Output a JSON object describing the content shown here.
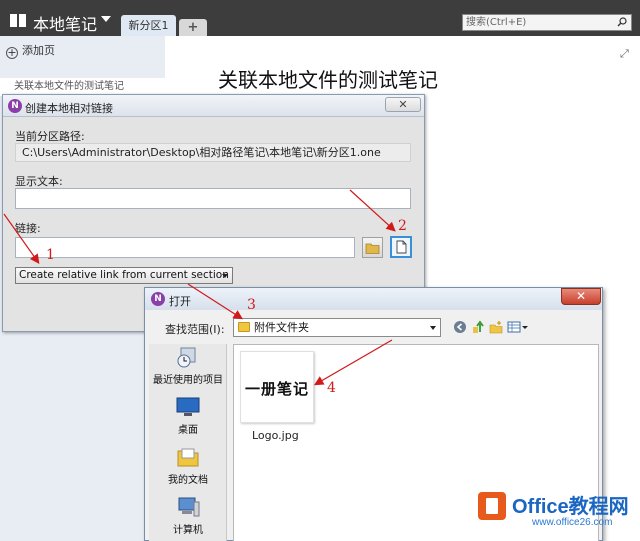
{
  "app": {
    "notebook_name": "本地笔记",
    "active_section_tab": "新分区1",
    "add_tab_label": "+",
    "search_placeholder": "搜索(Ctrl+E)"
  },
  "page_pane": {
    "add_page_label": "添加页",
    "pages": [
      "关联本地文件的测试笔记"
    ]
  },
  "main": {
    "page_title": "关联本地文件的测试笔记",
    "expand_label": "⤢"
  },
  "link_dialog": {
    "title": "创建本地相对链接",
    "close_label": "✕",
    "section_path_label": "当前分区路径:",
    "section_path_value": "C:\\Users\\Administrator\\Desktop\\相对路径笔记\\本地笔记\\新分区1.one",
    "display_text_label": "显示文本:",
    "display_text_value": "",
    "link_label": "链接:",
    "link_value": "",
    "relative_mode_selected": "Create relative link from current section"
  },
  "open_dialog": {
    "title": "打开",
    "close_label": "✕",
    "look_in_label": "查找范围(I):",
    "look_in_value": "附件文件夹",
    "places": [
      "最近使用的项目",
      "桌面",
      "我的文档",
      "计算机"
    ],
    "files": [
      {
        "name": "Logo.jpg",
        "thumbnail_text": "一册笔记"
      }
    ]
  },
  "annotations": [
    "1",
    "2",
    "3",
    "4"
  ],
  "watermark": {
    "brand": "Office教程网",
    "url": "www.office26.com"
  },
  "colors": {
    "titlebar": "#3d3d3d",
    "annotation_red": "#d11a1a",
    "onenote_purple": "#8b3fa9",
    "watermark_orange": "#e85a1c",
    "watermark_blue": "#1a66c2"
  }
}
